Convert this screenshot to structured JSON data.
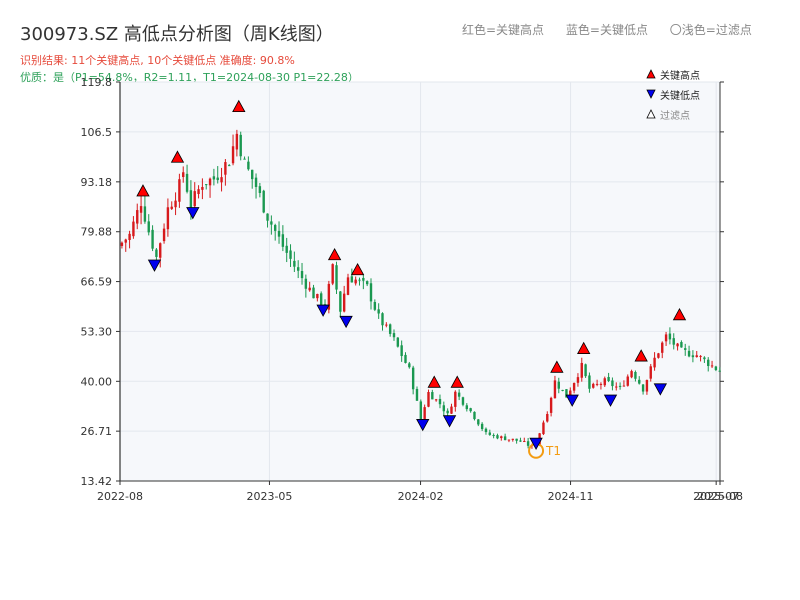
{
  "header": {
    "title": "300973.SZ 高低点分析图（周K线图）",
    "legend_red": "红色=关键高点",
    "legend_blue": "蓝色=关键低点",
    "legend_filtered": "〇浅色=过滤点",
    "result_text": "识别结果: 11个关键高点, 10个关键低点   准确度: 90.8%",
    "quality_text": "优质：是（P1=54.8%，R2=1.11，T1=2024-08-30 P1=22.28）"
  },
  "legend": {
    "high": "关键高点",
    "low": "关键低点",
    "filtered": "过滤点"
  },
  "colors": {
    "up": "#d7191c",
    "down": "#1a9850",
    "high_marker": "#ff0000",
    "low_marker": "#0000ee",
    "t1_ring": "#f39c12",
    "plot_bg": "#f6f8fb",
    "grid": "#e3e7ee"
  },
  "chart_data": {
    "type": "candlestick",
    "ylim": [
      13.42,
      119.8
    ],
    "yticks": [
      13.42,
      26.71,
      40.0,
      53.3,
      66.59,
      79.88,
      93.18,
      106.5,
      119.8
    ],
    "ytick_labels": [
      "13.42",
      "26.71",
      "40.00",
      "53.30",
      "66.59",
      "79.88",
      "93.18",
      "106.5",
      "119.8"
    ],
    "xlim": [
      "2022-08-01",
      "2025-08-01"
    ],
    "xticks": [
      {
        "date": "2022-08-01",
        "label": "2022-08"
      },
      {
        "date": "2023-05-01",
        "label": "2023-05"
      },
      {
        "date": "2024-02-01",
        "label": "2024-02"
      },
      {
        "date": "2024-11-01",
        "label": "2024-11"
      },
      {
        "date": "2025-07-25",
        "label": "2025-07"
      },
      {
        "date": "2025-08-01",
        "label": "2025-08"
      }
    ],
    "price_path": [
      [
        "2022-08-01",
        76
      ],
      [
        "2022-08-22",
        79
      ],
      [
        "2022-09-12",
        88
      ],
      [
        "2022-09-26",
        80
      ],
      [
        "2022-10-10",
        73
      ],
      [
        "2022-10-31",
        86
      ],
      [
        "2022-11-21",
        92
      ],
      [
        "2022-11-28",
        96
      ],
      [
        "2022-12-12",
        87
      ],
      [
        "2023-01-02",
        93
      ],
      [
        "2023-01-23",
        94
      ],
      [
        "2023-02-20",
        99
      ],
      [
        "2023-03-06",
        106
      ],
      [
        "2023-03-20",
        98
      ],
      [
        "2023-04-10",
        92
      ],
      [
        "2023-05-01",
        84
      ],
      [
        "2023-05-29",
        76
      ],
      [
        "2023-06-26",
        69
      ],
      [
        "2023-07-24",
        63
      ],
      [
        "2023-08-14",
        60
      ],
      [
        "2023-08-28",
        70
      ],
      [
        "2023-09-11",
        59
      ],
      [
        "2023-09-25",
        68
      ],
      [
        "2023-10-09",
        67
      ],
      [
        "2023-10-30",
        65
      ],
      [
        "2023-11-20",
        57
      ],
      [
        "2023-12-18",
        51
      ],
      [
        "2024-01-15",
        43
      ],
      [
        "2024-02-05",
        30
      ],
      [
        "2024-02-19",
        37
      ],
      [
        "2024-03-11",
        34
      ],
      [
        "2024-03-25",
        31
      ],
      [
        "2024-04-08",
        37
      ],
      [
        "2024-05-06",
        32
      ],
      [
        "2024-06-03",
        26
      ],
      [
        "2024-07-01",
        25
      ],
      [
        "2024-08-05",
        24
      ],
      [
        "2024-08-30",
        22.28
      ],
      [
        "2024-09-23",
        32
      ],
      [
        "2024-10-07",
        40
      ],
      [
        "2024-10-28",
        36
      ],
      [
        "2024-11-11",
        40
      ],
      [
        "2024-11-25",
        44
      ],
      [
        "2024-12-09",
        38
      ],
      [
        "2025-01-06",
        40
      ],
      [
        "2025-02-03",
        38
      ],
      [
        "2025-02-24",
        43
      ],
      [
        "2025-03-17",
        38
      ],
      [
        "2025-04-07",
        46
      ],
      [
        "2025-04-28",
        52
      ],
      [
        "2025-05-26",
        48
      ],
      [
        "2025-06-23",
        47
      ],
      [
        "2025-08-01",
        43
      ]
    ],
    "key_highs": [
      {
        "date": "2022-09-12",
        "price": 91
      },
      {
        "date": "2022-11-14",
        "price": 100
      },
      {
        "date": "2023-03-06",
        "price": 113.5
      },
      {
        "date": "2023-08-28",
        "price": 74
      },
      {
        "date": "2023-10-09",
        "price": 70
      },
      {
        "date": "2024-02-26",
        "price": 40
      },
      {
        "date": "2024-04-08",
        "price": 40
      },
      {
        "date": "2024-10-07",
        "price": 44
      },
      {
        "date": "2024-11-25",
        "price": 49
      },
      {
        "date": "2025-03-10",
        "price": 47
      },
      {
        "date": "2025-05-19",
        "price": 58
      }
    ],
    "key_lows": [
      {
        "date": "2022-10-03",
        "price": 71
      },
      {
        "date": "2022-12-12",
        "price": 85
      },
      {
        "date": "2023-08-07",
        "price": 59
      },
      {
        "date": "2023-09-18",
        "price": 56
      },
      {
        "date": "2024-02-05",
        "price": 28.5
      },
      {
        "date": "2024-03-25",
        "price": 29.5
      },
      {
        "date": "2024-08-30",
        "price": 23.5
      },
      {
        "date": "2024-11-04",
        "price": 35
      },
      {
        "date": "2025-01-13",
        "price": 35
      },
      {
        "date": "2025-04-14",
        "price": 38
      }
    ],
    "t1": {
      "label": "T1",
      "date": "2024-08-30",
      "price": 22.28
    }
  }
}
